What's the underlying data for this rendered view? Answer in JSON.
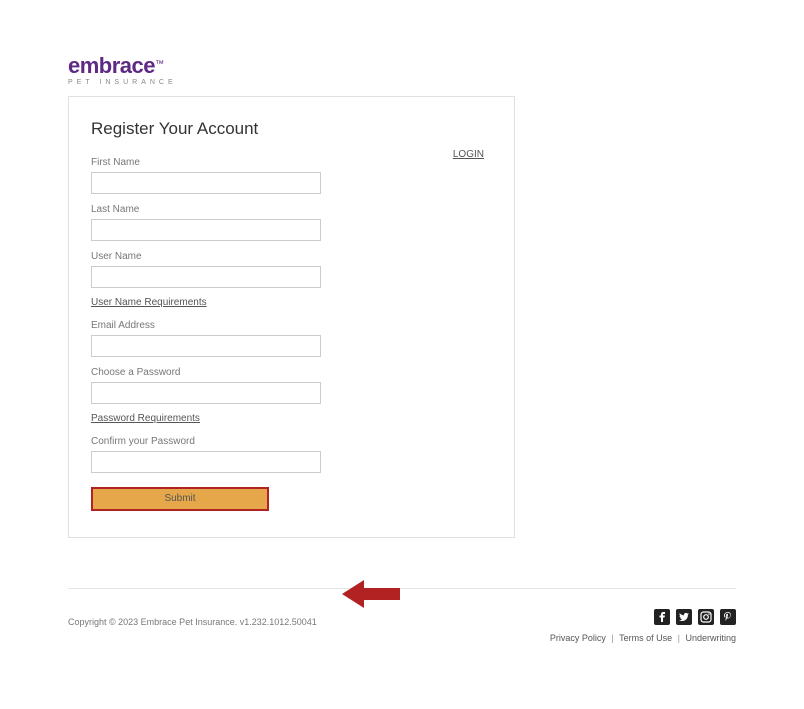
{
  "logo": {
    "brand": "embrace",
    "tm": "™",
    "tagline": "PET INSURANCE"
  },
  "card": {
    "title": "Register Your Account",
    "login_link": "LOGIN"
  },
  "fields": {
    "first_name_label": "First Name",
    "last_name_label": "Last Name",
    "user_name_label": "User Name",
    "username_req_link": "User Name Requirements",
    "email_label": "Email Address",
    "password_label": "Choose a Password",
    "password_req_link": "Password Requirements",
    "confirm_password_label": "Confirm your Password",
    "submit_label": "Submit"
  },
  "values": {
    "first_name": "",
    "last_name": "",
    "user_name": "",
    "email": "",
    "password": "",
    "confirm_password": ""
  },
  "footer": {
    "copyright": "Copyright © 2023   Embrace Pet Insurance. v1.232.1012.50041",
    "links": {
      "privacy": "Privacy Policy",
      "terms": "Terms of Use",
      "underwriting": "Underwriting"
    }
  }
}
